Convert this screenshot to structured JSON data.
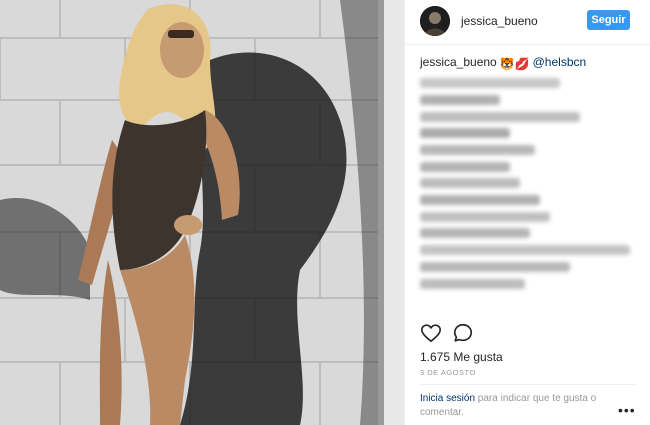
{
  "header": {
    "username": "jessica_bueno",
    "follow_label": "Seguir"
  },
  "caption": {
    "author": "jessica_bueno",
    "emoji": "🐯💋",
    "mention": "@helsbcn",
    "obscured_text": "blurred caption text (unreadable)"
  },
  "actions": {
    "like_icon": "heart-outline-icon",
    "comment_icon": "comment-bubble-icon"
  },
  "likes_text": "1.675 Me gusta",
  "date_text": "3 DE AGOSTO",
  "login_prompt": {
    "link": "Inicia sesión",
    "rest": " para indicar que te gusta o comentar."
  },
  "more_options": "•••",
  "colors": {
    "accent": "#3897f0",
    "link": "#003569",
    "muted": "#999999",
    "text": "#262626"
  }
}
